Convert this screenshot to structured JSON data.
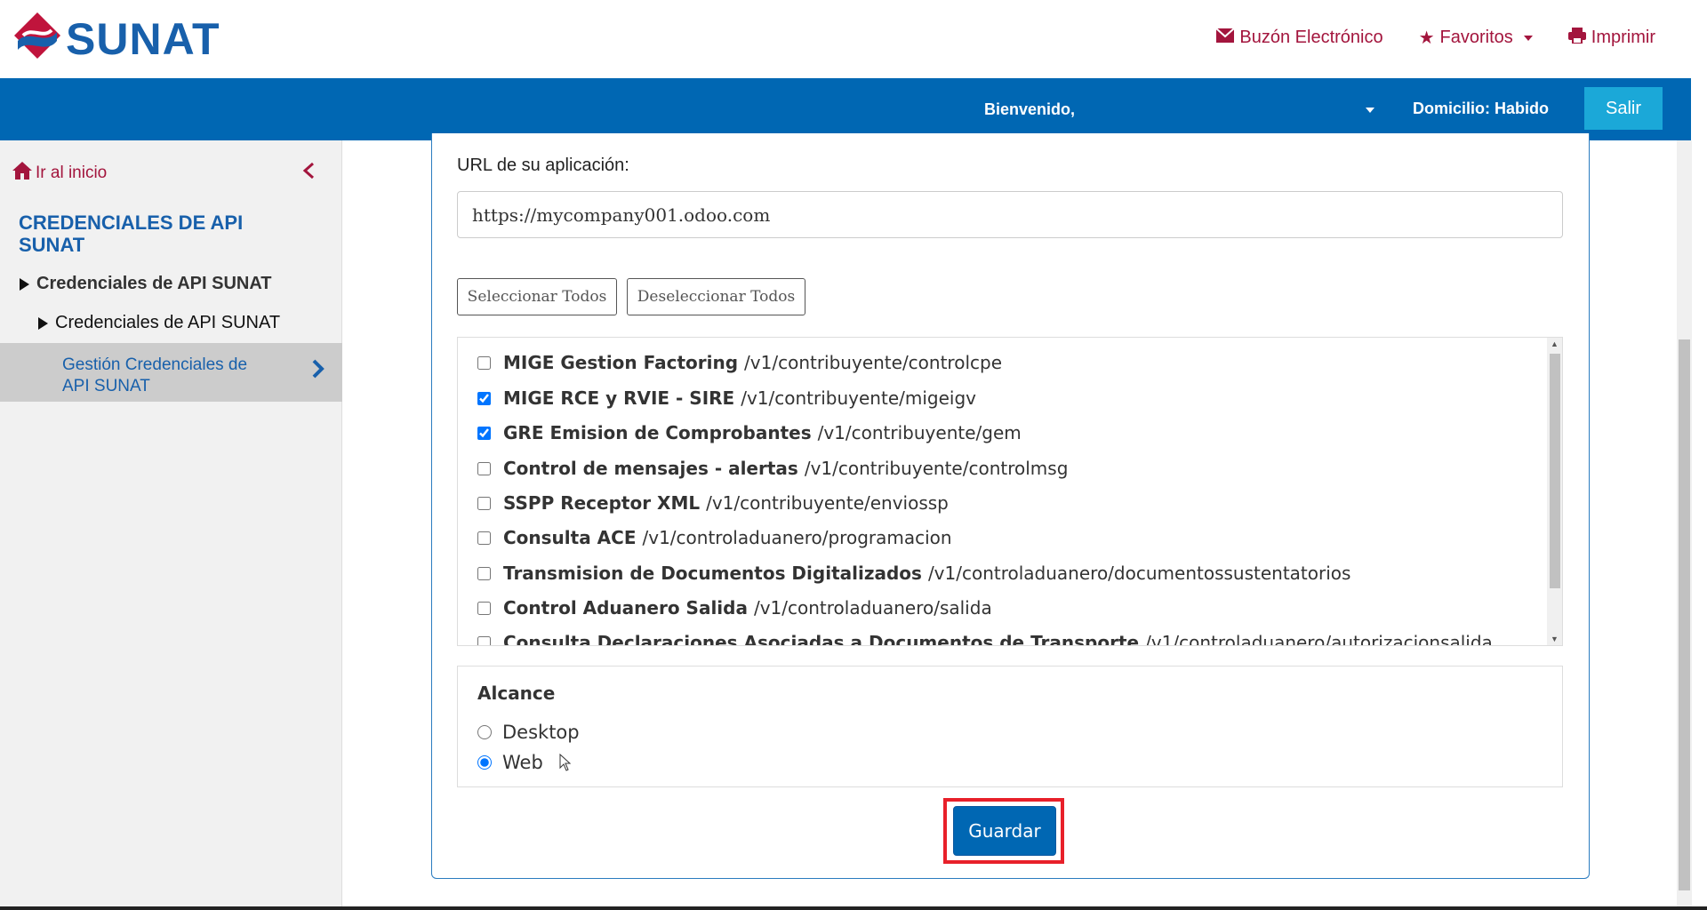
{
  "brand": {
    "logo_text": "SUNAT",
    "primary_color": "#0067b3",
    "accent_color": "#a3153d"
  },
  "top_links": {
    "buzon": "Buzón Electrónico",
    "favoritos": "Favoritos",
    "imprimir": "Imprimir"
  },
  "user_bar": {
    "welcome": "Bienvenido,",
    "domicilio": "Domicilio: Habido",
    "logout": "Salir"
  },
  "sidebar": {
    "home": "Ir al inicio",
    "title": "CREDENCIALES DE API SUNAT",
    "items": [
      {
        "label": "Credenciales de API SUNAT"
      },
      {
        "label": "Credenciales de API SUNAT"
      },
      {
        "label": "Gestión Credenciales de API SUNAT",
        "active": true
      }
    ]
  },
  "form": {
    "url_label": "URL de su aplicación:",
    "url_value": "https://mycompany001.odoo.com",
    "select_all": "Seleccionar Todos",
    "deselect_all": "Deseleccionar Todos",
    "apis": [
      {
        "name": "MIGE Gestion Factoring",
        "path": "/v1/contribuyente/controlcpe",
        "checked": false
      },
      {
        "name": "MIGE RCE y RVIE - SIRE",
        "path": "/v1/contribuyente/migeigv",
        "checked": true
      },
      {
        "name": "GRE Emision de Comprobantes",
        "path": "/v1/contribuyente/gem",
        "checked": true
      },
      {
        "name": "Control de mensajes - alertas",
        "path": "/v1/contribuyente/controlmsg",
        "checked": false
      },
      {
        "name": "SSPP Receptor XML",
        "path": "/v1/contribuyente/enviossp",
        "checked": false
      },
      {
        "name": "Consulta ACE",
        "path": "/v1/controladuanero/programacion",
        "checked": false
      },
      {
        "name": "Transmision de Documentos Digitalizados",
        "path": "/v1/controladuanero/documentossustentatorios",
        "checked": false
      },
      {
        "name": "Control Aduanero Salida",
        "path": "/v1/controladuanero/salida",
        "checked": false
      },
      {
        "name": "Consulta Declaraciones Asociadas a Documentos de Transporte",
        "path": "/v1/controladuanero/autorizacionsalida",
        "checked": false
      }
    ],
    "scope_title": "Alcance",
    "scope_options": [
      {
        "label": "Desktop",
        "checked": false
      },
      {
        "label": "Web",
        "checked": true
      }
    ],
    "save": "Guardar"
  }
}
